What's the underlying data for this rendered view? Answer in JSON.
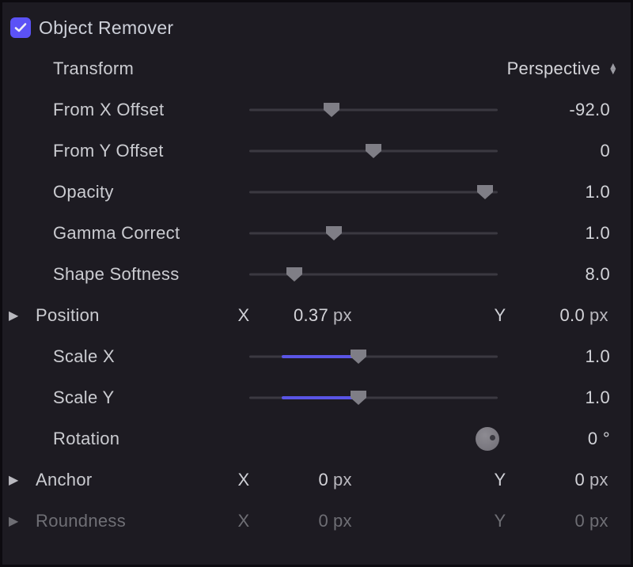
{
  "title": "Object Remover",
  "transform": {
    "label": "Transform",
    "value": "Perspective"
  },
  "sliders": {
    "from_x": {
      "label": "From X Offset",
      "value": "-92.0",
      "pos": 0.33,
      "fill": false
    },
    "from_y": {
      "label": "From Y Offset",
      "value": "0",
      "pos": 0.5,
      "fill": false
    },
    "opacity": {
      "label": "Opacity",
      "value": "1.0",
      "pos": 0.95,
      "fill": false
    },
    "gamma": {
      "label": "Gamma Correct",
      "value": "1.0",
      "pos": 0.34,
      "fill": false
    },
    "soft": {
      "label": "Shape Softness",
      "value": "8.0",
      "pos": 0.18,
      "fill": false
    },
    "scale_x": {
      "label": "Scale X",
      "value": "1.0",
      "pos": 0.44,
      "fill": true,
      "fill_start": 0.13
    },
    "scale_y": {
      "label": "Scale Y",
      "value": "1.0",
      "pos": 0.44,
      "fill": true,
      "fill_start": 0.13
    }
  },
  "position": {
    "label": "Position",
    "x_label": "X",
    "x_value": "0.37",
    "x_unit": "px",
    "y_label": "Y",
    "y_value": "0.0",
    "y_unit": "px"
  },
  "rotation": {
    "label": "Rotation",
    "value": "0",
    "unit": "°"
  },
  "anchor": {
    "label": "Anchor",
    "x_label": "X",
    "x_value": "0",
    "x_unit": "px",
    "y_label": "Y",
    "y_value": "0",
    "y_unit": "px"
  },
  "roundness": {
    "label": "Roundness",
    "x_label": "X",
    "x_value": "0",
    "x_unit": "px",
    "y_label": "Y",
    "y_value": "0",
    "y_unit": "px"
  }
}
